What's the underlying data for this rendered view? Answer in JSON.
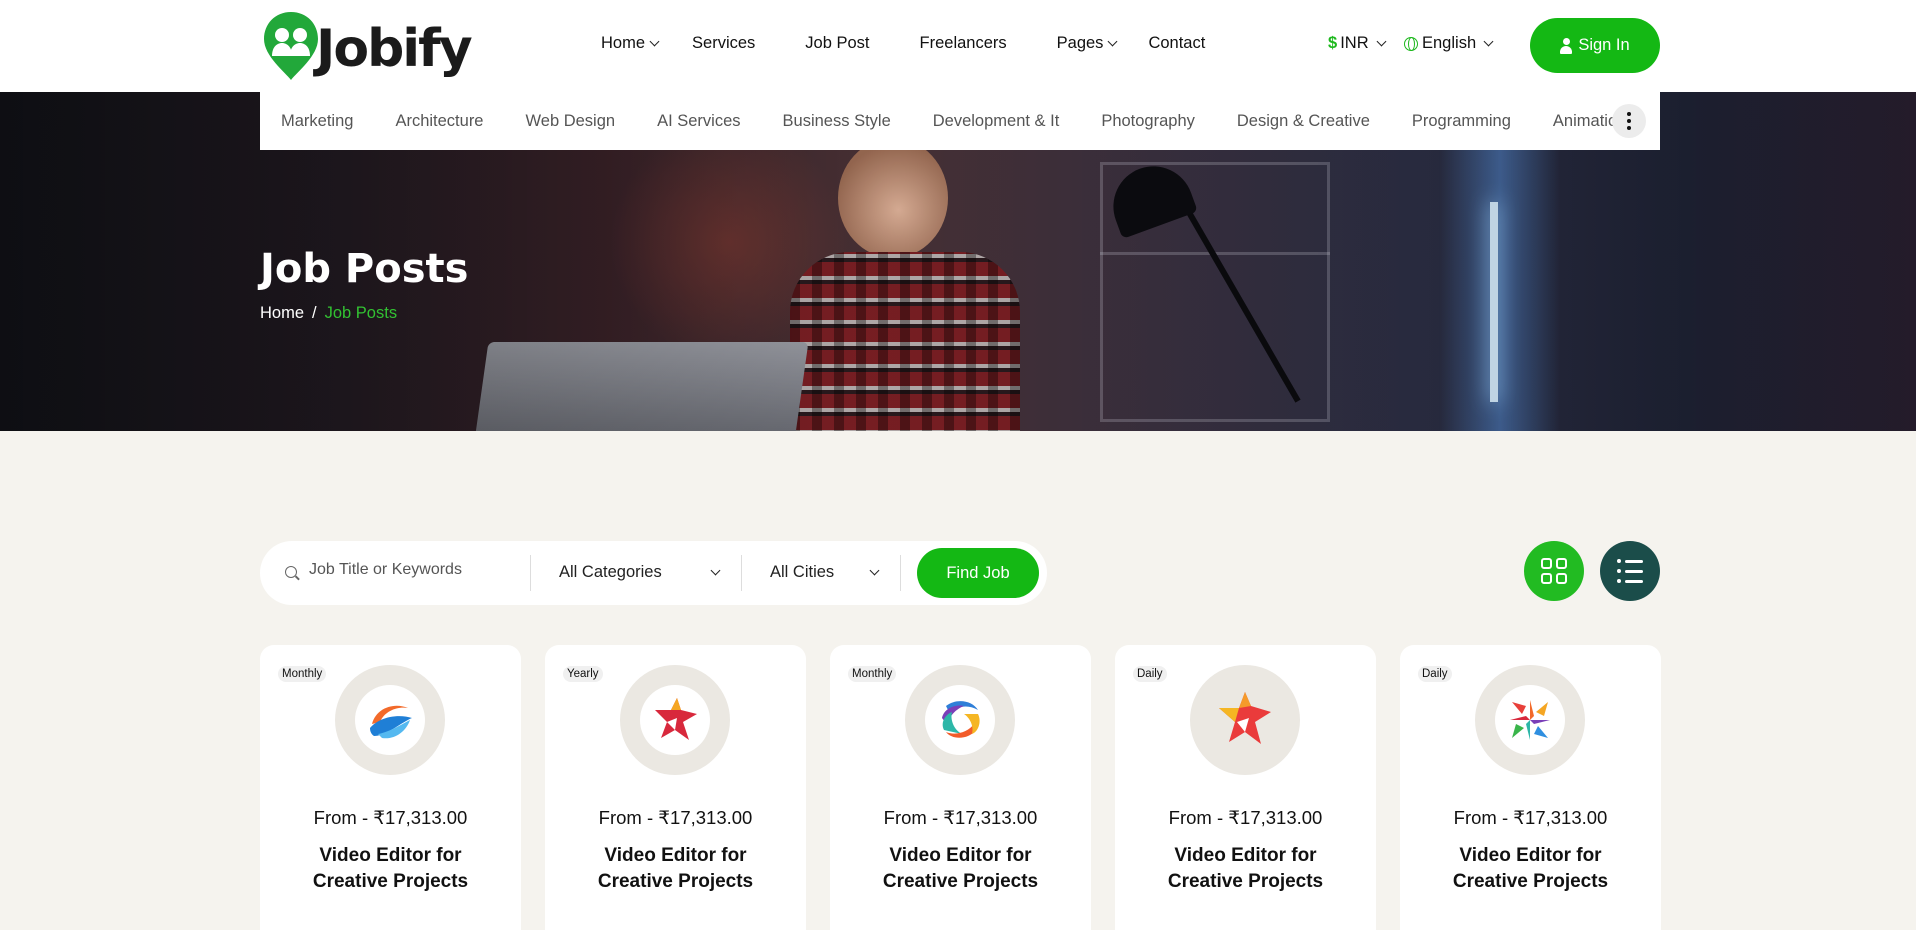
{
  "brand": {
    "name": "Jobify",
    "accent": "#14b814",
    "dark_accent": "#1b4d4a"
  },
  "nav": [
    {
      "label": "Home",
      "dropdown": true
    },
    {
      "label": "Services",
      "dropdown": false
    },
    {
      "label": "Job Post",
      "dropdown": false
    },
    {
      "label": "Freelancers",
      "dropdown": false
    },
    {
      "label": "Pages",
      "dropdown": true
    },
    {
      "label": "Contact",
      "dropdown": false
    }
  ],
  "currency": {
    "symbol": "$",
    "label": "INR"
  },
  "language": {
    "label": "English",
    "icon": "globe-icon"
  },
  "signin": {
    "label": "Sign In",
    "icon": "user-icon"
  },
  "categories": [
    "Marketing",
    "Architecture",
    "Web Design",
    "AI Services",
    "Business Style",
    "Development & It",
    "Photography",
    "Design & Creative",
    "Programming",
    "Animation"
  ],
  "hero": {
    "title": "Job Posts",
    "breadcrumb": {
      "home": "Home",
      "separator": "/",
      "current": "Job Posts"
    }
  },
  "search": {
    "placeholder": "Job Title or Keywords",
    "category": "All Categories",
    "city": "All Cities",
    "button": "Find Job"
  },
  "view_toggle": {
    "grid_icon": "grid-icon",
    "list_icon": "list-icon"
  },
  "jobs": [
    {
      "period": "Monthly",
      "price": "From - ₹17,313.00",
      "title": "Video Editor for Creative Projects",
      "logo": "swirl-blue-logo"
    },
    {
      "period": "Yearly",
      "price": "From - ₹17,313.00",
      "title": "Video Editor for Creative Projects",
      "logo": "star-red-logo"
    },
    {
      "period": "Monthly",
      "price": "From - ₹17,313.00",
      "title": "Video Editor for Creative Projects",
      "logo": "rainbow-swirl-logo"
    },
    {
      "period": "Daily",
      "price": "From - ₹17,313.00",
      "title": "Video Editor for Creative Projects",
      "logo": "star-orange-logo"
    },
    {
      "period": "Daily",
      "price": "From - ₹17,313.00",
      "title": "Video Editor for Creative Projects",
      "logo": "cross-color-logo"
    }
  ]
}
